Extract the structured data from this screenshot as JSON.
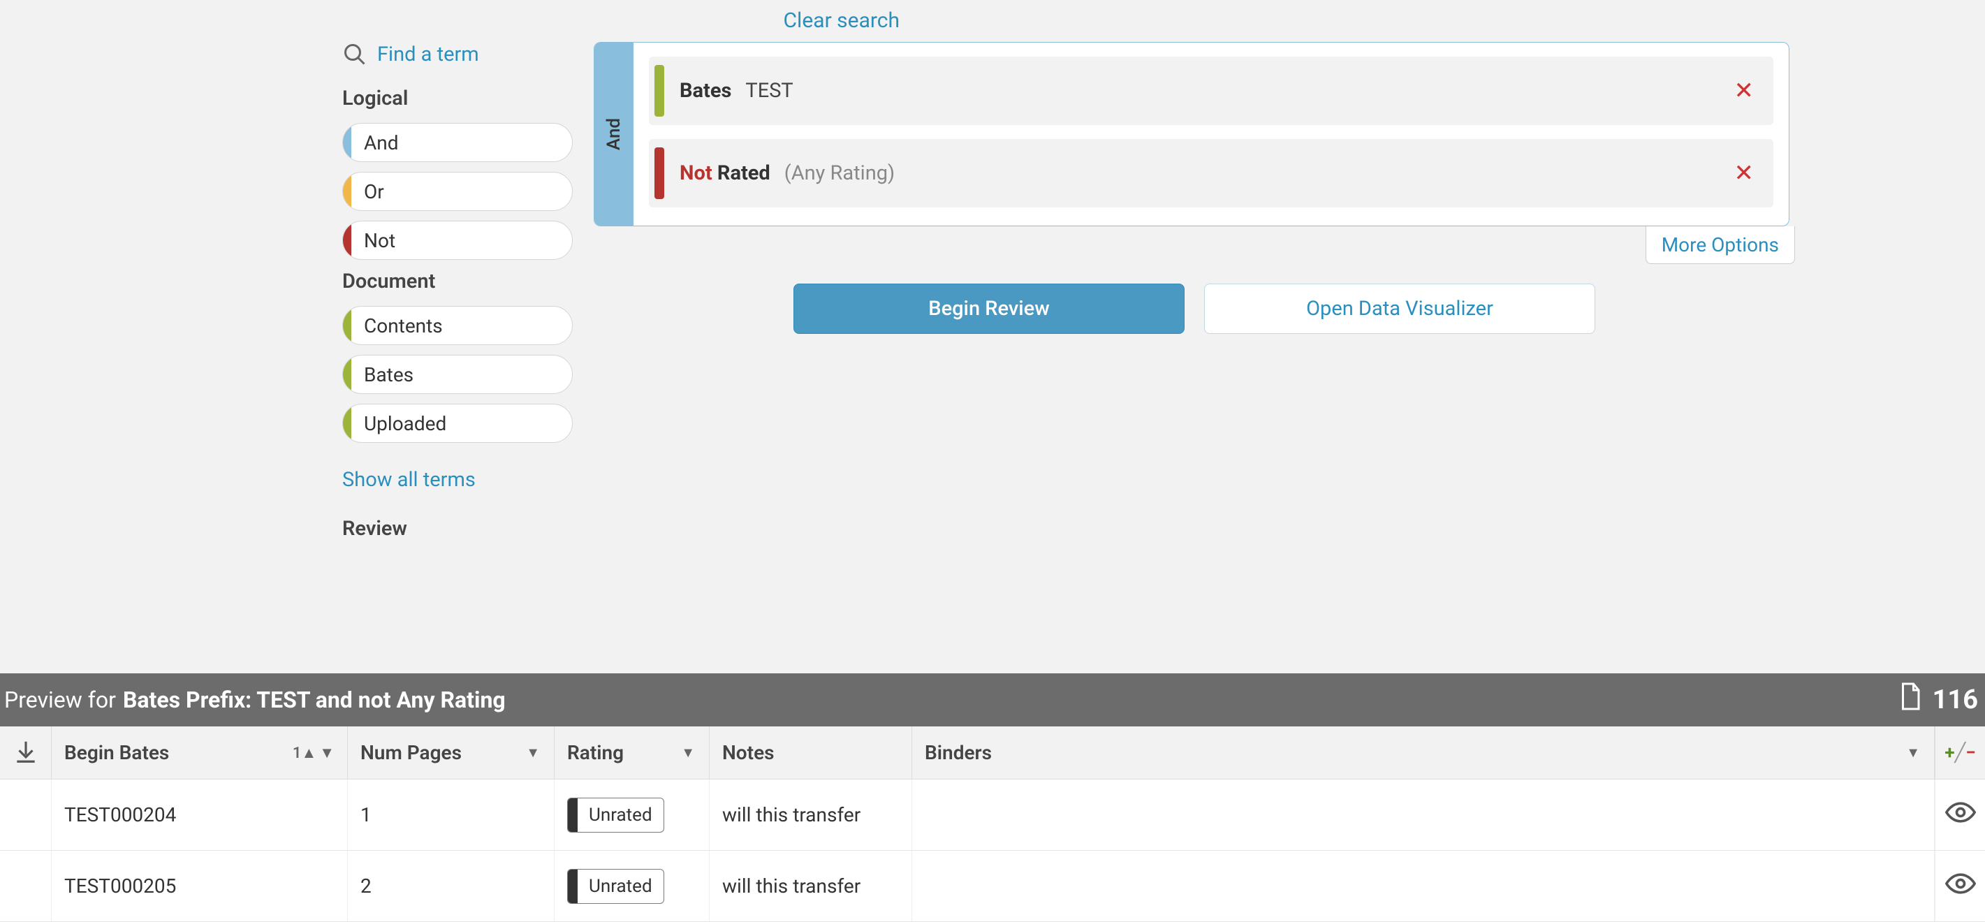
{
  "header": {
    "clear_search": "Clear search"
  },
  "sidebar": {
    "find_term": "Find a term",
    "groups": [
      {
        "title": "Logical",
        "items": [
          {
            "label": "And",
            "color": "blue"
          },
          {
            "label": "Or",
            "color": "yellow"
          },
          {
            "label": "Not",
            "color": "red"
          }
        ]
      },
      {
        "title": "Document",
        "items": [
          {
            "label": "Contents",
            "color": "green"
          },
          {
            "label": "Bates",
            "color": "green"
          },
          {
            "label": "Uploaded",
            "color": "green"
          }
        ]
      }
    ],
    "show_all": "Show all terms",
    "review_title": "Review"
  },
  "query": {
    "group_operator": "And",
    "conditions": [
      {
        "bar": "green",
        "prefix": "",
        "key": "Bates",
        "value": "TEST",
        "paren": ""
      },
      {
        "bar": "red",
        "prefix": "Not",
        "key": "Rated",
        "value": "",
        "paren": "(Any Rating)"
      }
    ],
    "more_options": "More Options"
  },
  "actions": {
    "begin_review": "Begin Review",
    "open_visualizer": "Open Data Visualizer"
  },
  "preview": {
    "lead": "Preview for",
    "query_text": "Bates Prefix: TEST and not Any Rating",
    "doc_count": "116",
    "columns": {
      "begin_bates": "Begin Bates",
      "num_pages": "Num Pages",
      "rating": "Rating",
      "notes": "Notes",
      "binders": "Binders",
      "sort_indicator": "1▲"
    },
    "rows": [
      {
        "bates": "TEST000204",
        "pages": "1",
        "rating": "Unrated",
        "notes": "will this transfer",
        "binders": ""
      },
      {
        "bates": "TEST000205",
        "pages": "2",
        "rating": "Unrated",
        "notes": "will this transfer",
        "binders": ""
      }
    ]
  }
}
